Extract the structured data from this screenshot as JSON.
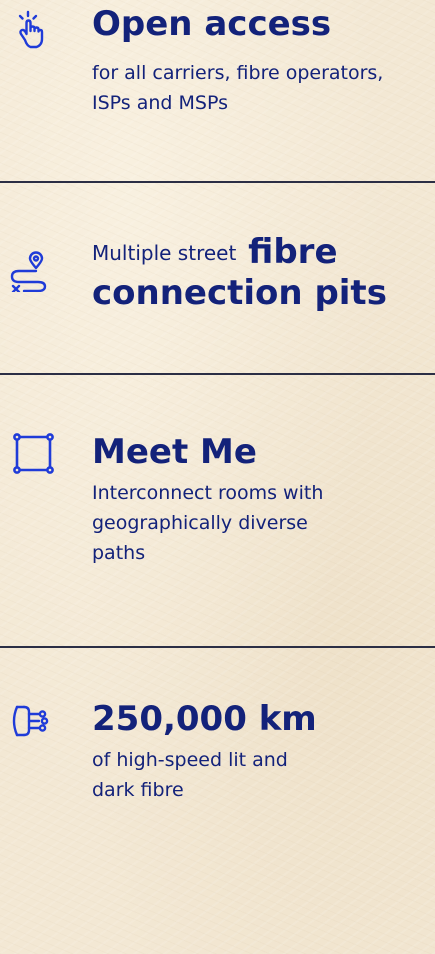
{
  "features": [
    {
      "icon": "tap-hand-icon",
      "title": "Open access",
      "subtitle": "for all carriers, fibre operators, ISPs and MSPs"
    },
    {
      "icon": "route-pin-icon",
      "title_small": "Multiple street",
      "title_bold_1": "fibre",
      "title_bold_2": "connection pits"
    },
    {
      "icon": "square-frame-icon",
      "title": "Meet Me",
      "subtitle": "Interconnect rooms with geographically diverse paths"
    },
    {
      "icon": "fibre-cable-icon",
      "title": "250,000 km",
      "subtitle": "of high-speed lit and dark fibre"
    }
  ],
  "colors": {
    "text": "#13227a",
    "icon": "#1f3bd8",
    "background": "#f3e8d4",
    "divider": "#2b2e45"
  }
}
